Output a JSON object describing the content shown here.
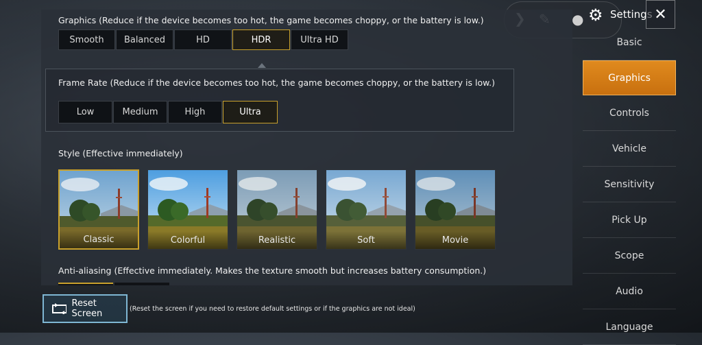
{
  "header": {
    "title": "Settings",
    "close_label": "✕",
    "icons": [
      "chevron-right-icon",
      "pencil-icon",
      "person-icon",
      "gear-icon",
      "close-icon"
    ]
  },
  "graphics": {
    "label": "Graphics (Reduce if the device becomes too hot, the game becomes choppy, or the battery is low.)",
    "options": [
      "Smooth",
      "Balanced",
      "HD",
      "HDR",
      "Ultra HD"
    ],
    "selected": "HDR"
  },
  "frame_rate": {
    "label": "Frame Rate (Reduce if the device becomes too hot, the game becomes choppy, or the battery is low.)",
    "options": [
      "Low",
      "Medium",
      "High",
      "Ultra"
    ],
    "selected": "Ultra"
  },
  "style": {
    "label": "Style (Effective immediately)",
    "options": [
      "Classic",
      "Colorful",
      "Realistic",
      "Soft",
      "Movie"
    ],
    "selected": "Classic"
  },
  "anti_aliasing": {
    "label": "Anti-aliasing (Effective immediately. Makes the texture smooth but increases battery consumption.)"
  },
  "sidebar": {
    "items": [
      "Basic",
      "Graphics",
      "Controls",
      "Vehicle",
      "Sensitivity",
      "Pick Up",
      "Scope",
      "Audio",
      "Language"
    ],
    "active": "Graphics"
  },
  "reset": {
    "button_label": "Reset Screen",
    "note": "(Reset the screen if you need to restore default settings or if the graphics are not ideal)"
  },
  "colors": {
    "accent_gold": "#c9a12c",
    "active_tab": "#e08a1e",
    "reset_border": "#7fb7d4"
  }
}
